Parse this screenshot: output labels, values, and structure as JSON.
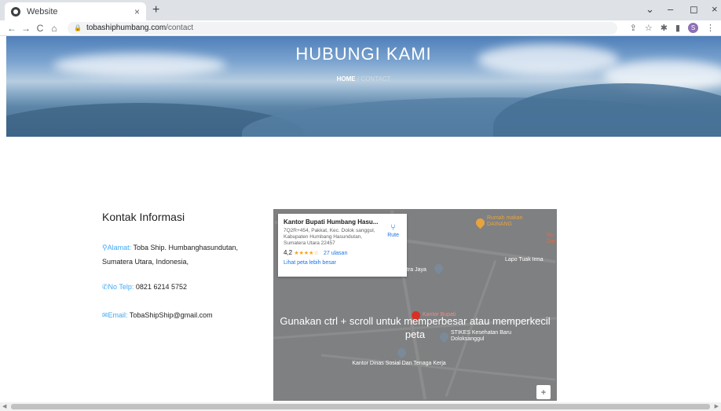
{
  "browser": {
    "tab_title": "Website",
    "tab_close": "×",
    "new_tab": "+",
    "url_host": "tobashiphumbang.com",
    "url_path": "/contact",
    "profile_initial": "S"
  },
  "hero": {
    "title": "HUBUNGI KAMI",
    "crumb_home": "HOME",
    "crumb_sep": " / ",
    "crumb_current": "CONTACT"
  },
  "contact": {
    "heading": "Kontak Informasi",
    "address_label": "Alamat:",
    "address_value": "Toba Ship. Humbanghasundutan, Sumatera Utara, Indonesia,",
    "phone_label": "No Telp:",
    "phone_value": "0821 6214 5752",
    "email_label": "Email:",
    "email_value": "TobaShipShip@gmail.com"
  },
  "map": {
    "place_name": "Kantor Bupati Humbang Hasu...",
    "place_address": "7Q2R+454, Pakkat, Kec. Dolok sanggul, Kabupaten Humbang Hasundutan, Sumatera Utara 22457",
    "rating": "4,2",
    "stars": "★★★★☆",
    "reviews": "27 ulasan",
    "directions_label": "Rute",
    "larger_map_link": "Lihat peta lebih besar",
    "overlay_message": "Gunakan ctrl + scroll untuk memperbesar atau memperkecil peta",
    "poi_1": "Rumah makan DAINANG",
    "poi_2": "Lapo Tuak Irma",
    "poi_3": "tra Jaya",
    "poi_4": "Kantor Bupati",
    "poi_5": "STIKES Kesehatan Baru Doloksanggul",
    "poi_6": "Kantor Dinas Sosial Dan Tenaga Kerja",
    "poi_7": "Ru Dar",
    "zoom_in": "+"
  },
  "colors": {
    "accent": "#3fa9f5",
    "map_link": "#1a73e8"
  }
}
